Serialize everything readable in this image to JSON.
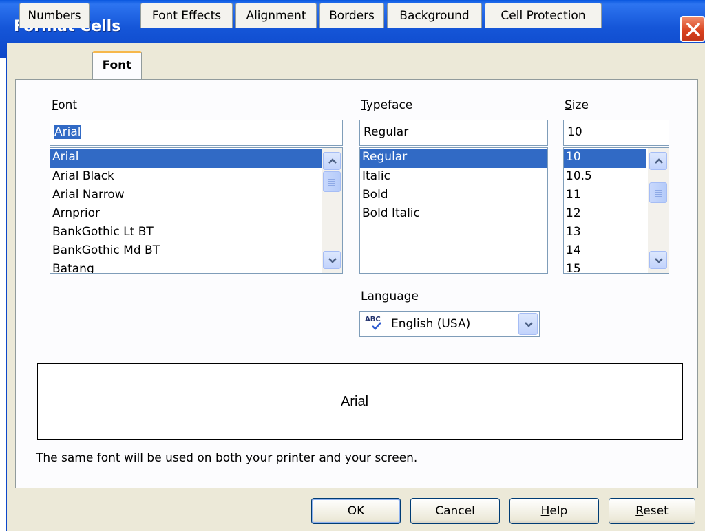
{
  "window": {
    "title": "Format Cells"
  },
  "tabs": [
    {
      "label": "Numbers",
      "active": false
    },
    {
      "label": "Font",
      "active": true
    },
    {
      "label": "Font Effects",
      "active": false
    },
    {
      "label": "Alignment",
      "active": false
    },
    {
      "label": "Borders",
      "active": false
    },
    {
      "label": "Background",
      "active": false
    },
    {
      "label": "Cell Protection",
      "active": false
    }
  ],
  "font": {
    "label_underlined": "F",
    "label_rest": "ont",
    "value": "Arial",
    "items": [
      "Arial",
      "Arial Black",
      "Arial Narrow",
      "Arnprior",
      "BankGothic Lt BT",
      "BankGothic Md BT",
      "Batang"
    ],
    "selected": "Arial"
  },
  "typeface": {
    "label_underlined": "T",
    "label_rest": "ypeface",
    "value": "Regular",
    "items": [
      "Regular",
      "Italic",
      "Bold",
      "Bold Italic"
    ],
    "selected": "Regular"
  },
  "size": {
    "label_underlined": "S",
    "label_rest": "ize",
    "value": "10",
    "items": [
      "10",
      "10.5",
      "11",
      "12",
      "13",
      "14",
      "15"
    ],
    "selected": "10"
  },
  "language": {
    "label_underlined": "L",
    "label_rest": "anguage",
    "value": "English (USA)",
    "icon_text": "ABC"
  },
  "preview": {
    "text": "Arial"
  },
  "info_text": "The same font will be used on both your printer and your screen.",
  "buttons": {
    "ok": "OK",
    "cancel": "Cancel",
    "help_underlined": "H",
    "help_rest": "elp",
    "reset_underlined": "R",
    "reset_rest": "eset"
  },
  "colors": {
    "title_bar": "#0d47c9",
    "selection": "#316ac5",
    "dialog_bg": "#ece9d8",
    "tab_accent": "#f6b74b"
  }
}
